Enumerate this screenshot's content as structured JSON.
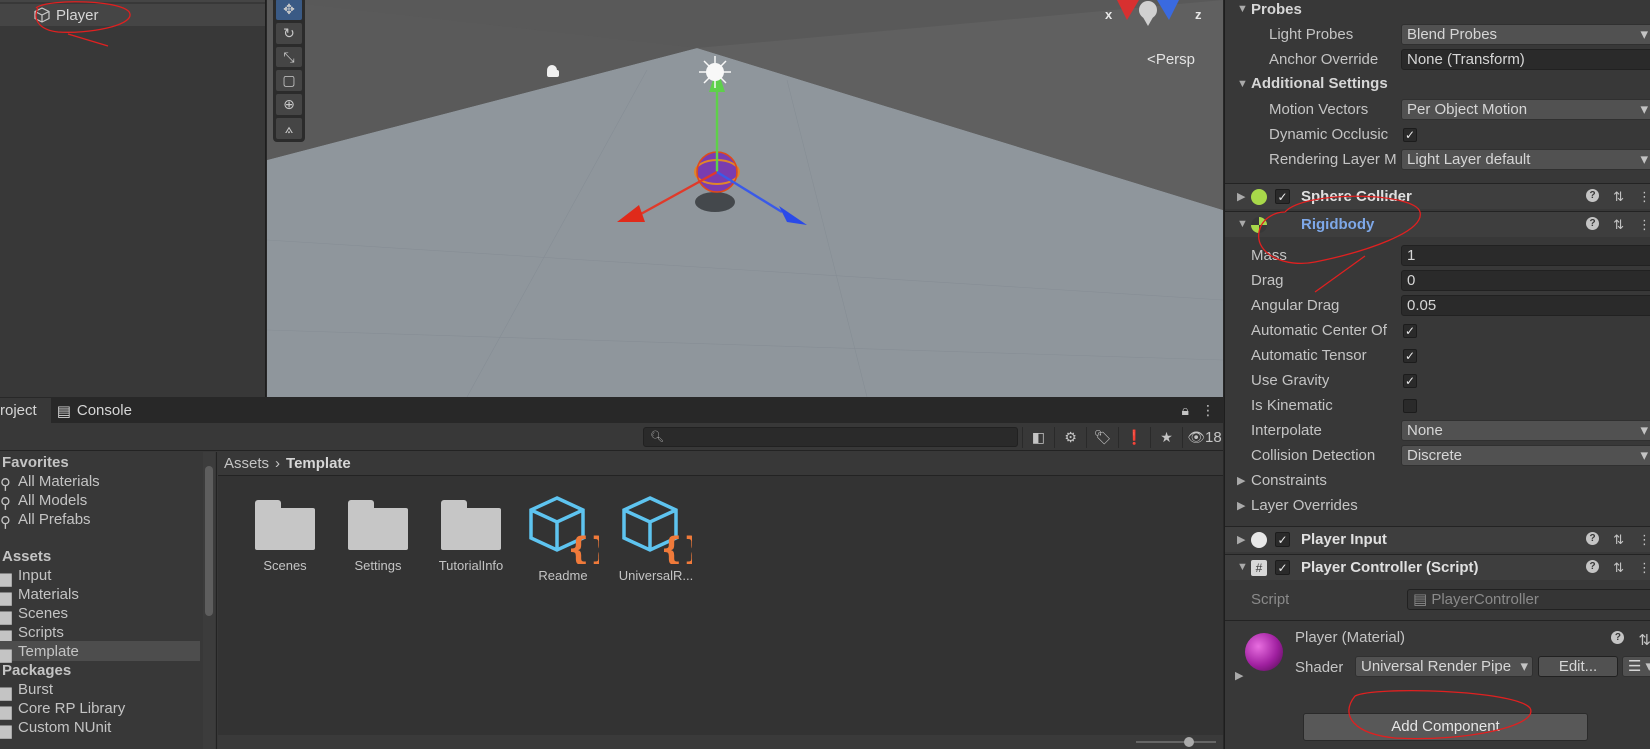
{
  "hierarchy": {
    "selected_item": "Player"
  },
  "scene": {
    "view_mode": "Persp",
    "axis_x": "x",
    "axis_z": "z"
  },
  "project": {
    "tabs": [
      {
        "label": "roject"
      },
      {
        "label": "Console"
      }
    ],
    "search_placeholder": "",
    "hidden_count": "18",
    "tree": {
      "favorites_header": "Favorites",
      "favorites": [
        "All Materials",
        "All Models",
        "All Prefabs"
      ],
      "assets_header": "Assets",
      "assets": [
        "Input",
        "Materials",
        "Scenes",
        "Scripts",
        "Template"
      ],
      "packages_header": "Packages",
      "packages": [
        "Burst",
        "Core RP Library",
        "Custom NUnit"
      ]
    },
    "breadcrumb": {
      "root": "Assets",
      "current": "Template"
    },
    "items": [
      {
        "label": "Scenes",
        "kind": "folder"
      },
      {
        "label": "Settings",
        "kind": "folder"
      },
      {
        "label": "TutorialInfo",
        "kind": "folder"
      },
      {
        "label": "Readme",
        "kind": "script-asset"
      },
      {
        "label": "UniversalR...",
        "kind": "script-asset"
      }
    ]
  },
  "inspector": {
    "probes": {
      "title": "Probes",
      "light_probes_label": "Light Probes",
      "light_probes_value": "Blend Probes",
      "anchor_label": "Anchor Override",
      "anchor_value": "None (Transform)"
    },
    "additional": {
      "title": "Additional Settings",
      "motion_label": "Motion Vectors",
      "motion_value": "Per Object Motion",
      "dyn_occ_label": "Dynamic Occlusic",
      "render_layer_label": "Rendering Layer M",
      "render_layer_value": "Light Layer default"
    },
    "sphere_collider": "Sphere Collider",
    "rigidbody": {
      "title": "Rigidbody",
      "mass_label": "Mass",
      "mass_value": "1",
      "drag_label": "Drag",
      "drag_value": "0",
      "angular_label": "Angular Drag",
      "angular_value": "0.05",
      "auto_center_label": "Automatic Center Of",
      "auto_tensor_label": "Automatic Tensor",
      "gravity_label": "Use Gravity",
      "kinematic_label": "Is Kinematic",
      "interp_label": "Interpolate",
      "interp_value": "None",
      "collision_label": "Collision Detection",
      "collision_value": "Discrete",
      "constraints_label": "Constraints",
      "layer_overrides_label": "Layer Overrides"
    },
    "player_input": "Player Input",
    "player_controller": {
      "title": "Player Controller (Script)",
      "script_label": "Script",
      "script_value": "PlayerController"
    },
    "material": {
      "title": "Player (Material)",
      "shader_label": "Shader",
      "shader_value": "Universal Render Pipe",
      "edit_label": "Edit..."
    },
    "add_component": "Add Component"
  },
  "colors": {
    "annotation": "#e02020",
    "selection_blue": "#3a5a85"
  }
}
